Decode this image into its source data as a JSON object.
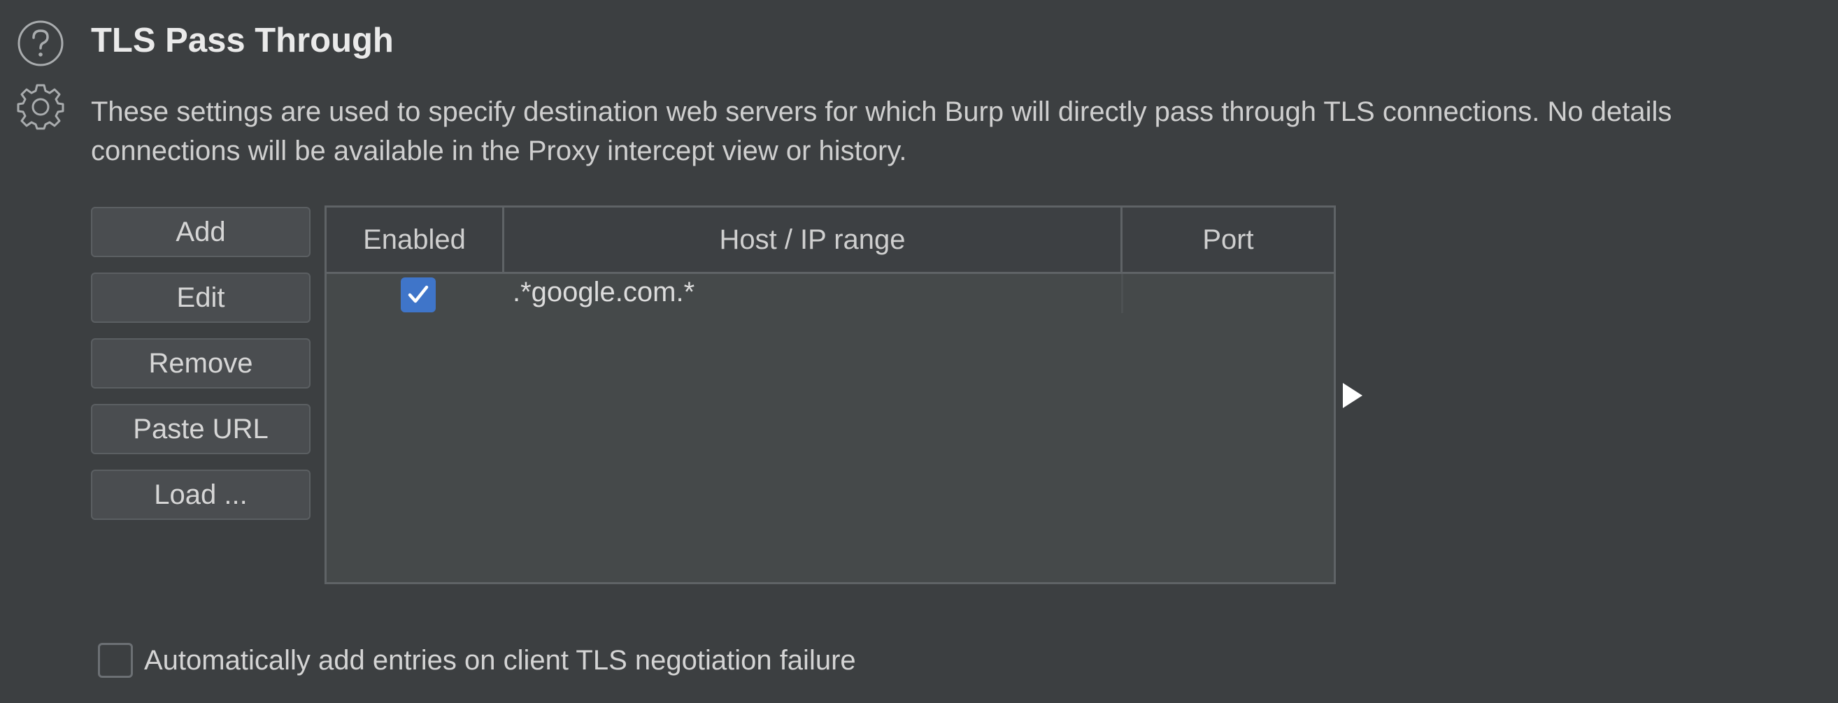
{
  "section": {
    "title": "TLS Pass Through",
    "description_line1": "These settings are used to specify destination web servers for which Burp will directly pass through TLS connections. No details",
    "description_line2": "connections will be available in the Proxy intercept view or history.",
    "help_icon": "help-icon",
    "settings_icon": "gear-icon"
  },
  "buttons": {
    "add": "Add",
    "edit": "Edit",
    "remove": "Remove",
    "paste_url": "Paste URL",
    "load": "Load ..."
  },
  "table": {
    "columns": [
      "Enabled",
      "Host / IP range",
      "Port"
    ],
    "rows": [
      {
        "enabled": true,
        "host": ".*google.com.*",
        "port": ""
      }
    ]
  },
  "auto_add": {
    "label": "Automatically add entries on client TLS negotiation failure",
    "checked": false
  },
  "colors": {
    "background": "#3c3f41",
    "checkbox_accent": "#3f75c9"
  }
}
